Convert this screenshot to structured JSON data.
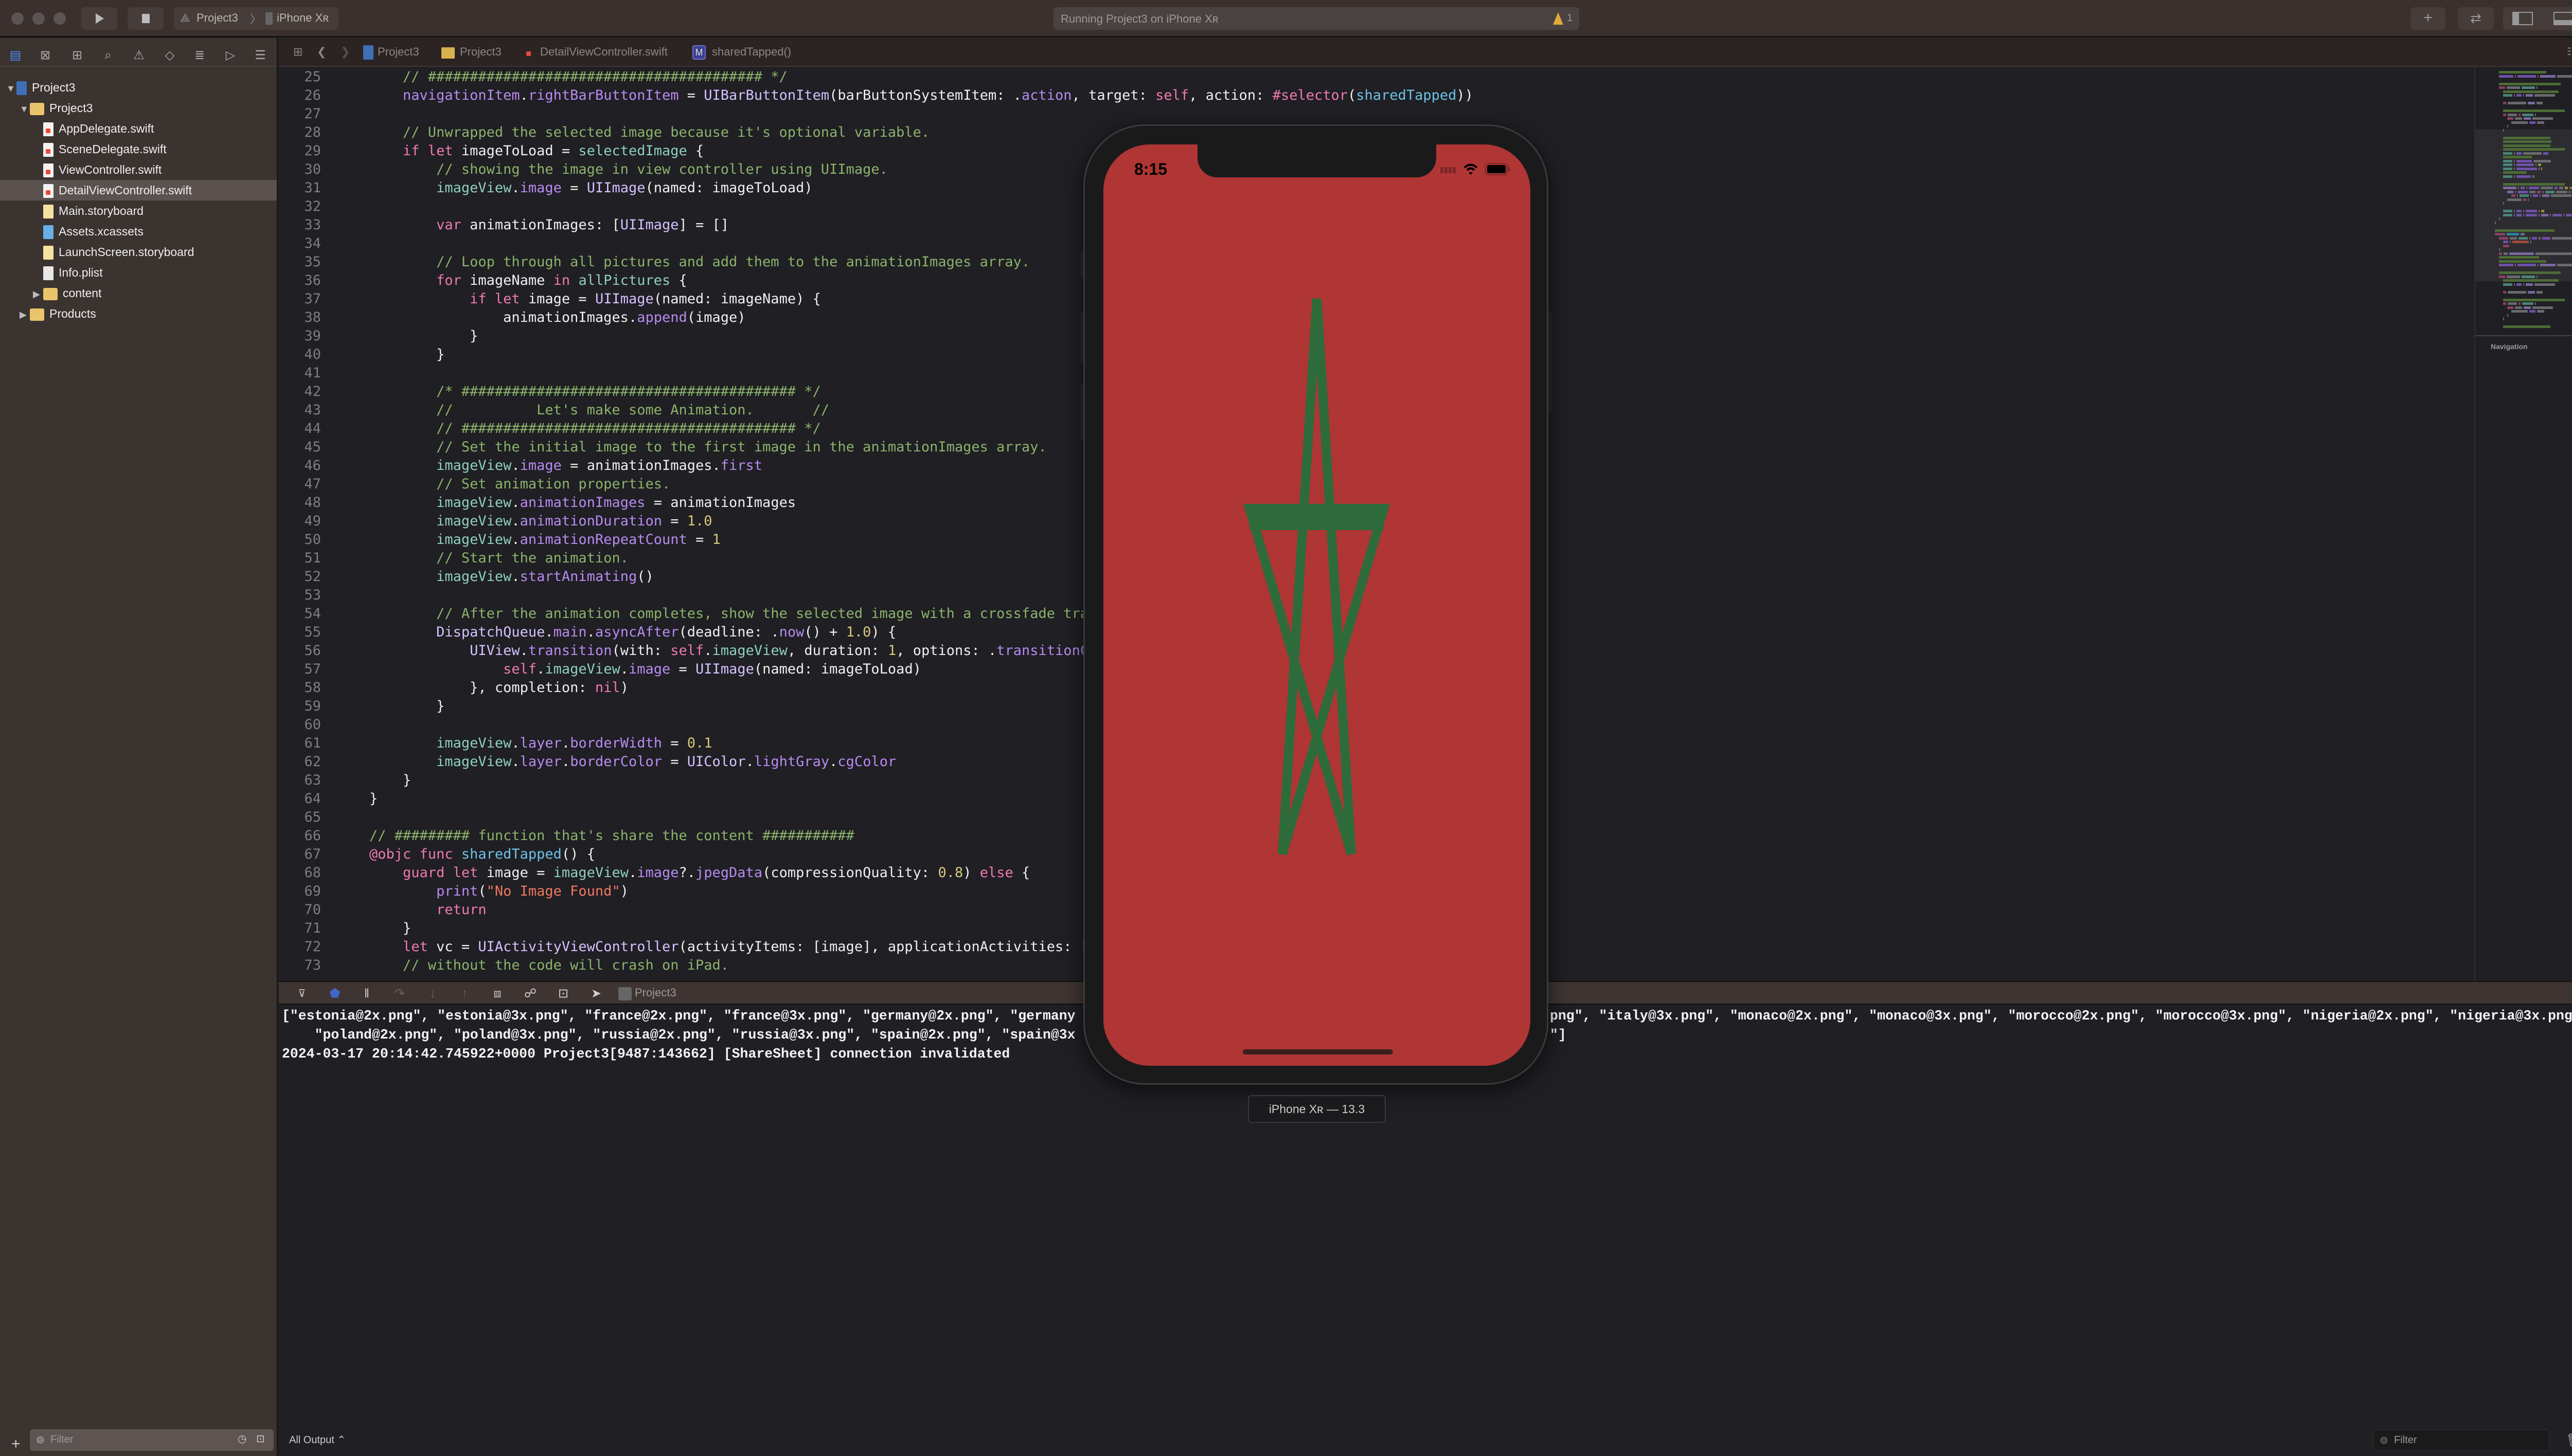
{
  "toolbar": {
    "scheme": "Project3",
    "device": "iPhone Xʀ",
    "activity": "Running Project3 on iPhone Xʀ",
    "warning_count": "1",
    "warning_color": "#e0a83a"
  },
  "navigator": {
    "items": [
      {
        "label": "Project3",
        "kind": "project"
      },
      {
        "label": "Project3",
        "kind": "folder"
      },
      {
        "label": "AppDelegate.swift",
        "kind": "swift"
      },
      {
        "label": "SceneDelegate.swift",
        "kind": "swift"
      },
      {
        "label": "ViewController.swift",
        "kind": "swift"
      },
      {
        "label": "DetailViewController.swift",
        "kind": "swift",
        "selected": true
      },
      {
        "label": "Main.storyboard",
        "kind": "storyboard"
      },
      {
        "label": "Assets.xcassets",
        "kind": "assets"
      },
      {
        "label": "LaunchScreen.storyboard",
        "kind": "storyboard"
      },
      {
        "label": "Info.plist",
        "kind": "plist"
      },
      {
        "label": "content",
        "kind": "folder"
      },
      {
        "label": "Products",
        "kind": "folder"
      }
    ],
    "filter_placeholder": "Filter"
  },
  "jumpbar": {
    "crumbs": [
      "Project3",
      "Project3",
      "DetailViewController.swift",
      "sharedTapped()"
    ],
    "method_badge": "M"
  },
  "editor": {
    "lines": [
      {
        "n": "25",
        "tokens": [
          {
            "t": "c",
            "v": "        // ######################################## */"
          }
        ]
      },
      {
        "n": "26",
        "tokens": [
          {
            "t": "f",
            "v": "        navigationItem"
          },
          {
            "t": "p",
            "v": "."
          },
          {
            "t": "f",
            "v": "rightBarButtonItem"
          },
          {
            "t": "p",
            "v": " = "
          },
          {
            "t": "y",
            "v": "UIBarButtonItem"
          },
          {
            "t": "p",
            "v": "(barButtonSystemItem: ."
          },
          {
            "t": "f",
            "v": "action"
          },
          {
            "t": "p",
            "v": ", target: "
          },
          {
            "t": "k",
            "v": "self"
          },
          {
            "t": "p",
            "v": ", action: "
          },
          {
            "t": "k",
            "v": "#selector"
          },
          {
            "t": "p",
            "v": "("
          },
          {
            "t": "d",
            "v": "sharedTapped"
          },
          {
            "t": "p",
            "v": "))"
          }
        ]
      },
      {
        "n": "27",
        "tokens": []
      },
      {
        "n": "28",
        "tokens": [
          {
            "t": "c",
            "v": "        // Unwrapped the selected image because it's optional variable."
          }
        ]
      },
      {
        "n": "29",
        "tokens": [
          {
            "t": "k",
            "v": "        if let"
          },
          {
            "t": "p",
            "v": " imageToLoad = "
          },
          {
            "t": "m",
            "v": "selectedImage"
          },
          {
            "t": "p",
            "v": " {"
          }
        ]
      },
      {
        "n": "30",
        "tokens": [
          {
            "t": "c",
            "v": "            // showing the image in view controller using UIImage."
          }
        ]
      },
      {
        "n": "31",
        "tokens": [
          {
            "t": "m",
            "v": "            imageView"
          },
          {
            "t": "p",
            "v": "."
          },
          {
            "t": "f",
            "v": "image"
          },
          {
            "t": "p",
            "v": " = "
          },
          {
            "t": "y",
            "v": "UIImage"
          },
          {
            "t": "p",
            "v": "(named: imageToLoad)"
          }
        ]
      },
      {
        "n": "32",
        "tokens": []
      },
      {
        "n": "33",
        "tokens": [
          {
            "t": "k",
            "v": "            var"
          },
          {
            "t": "p",
            "v": " animationImages: ["
          },
          {
            "t": "y",
            "v": "UIImage"
          },
          {
            "t": "p",
            "v": "] = []"
          }
        ]
      },
      {
        "n": "34",
        "tokens": []
      },
      {
        "n": "35",
        "tokens": [
          {
            "t": "c",
            "v": "            // Loop through all pictures and add them to the animationImages array."
          }
        ]
      },
      {
        "n": "36",
        "tokens": [
          {
            "t": "k",
            "v": "            for"
          },
          {
            "t": "p",
            "v": " imageName "
          },
          {
            "t": "k",
            "v": "in"
          },
          {
            "t": "p",
            "v": " "
          },
          {
            "t": "m",
            "v": "allPictures"
          },
          {
            "t": "p",
            "v": " {"
          }
        ]
      },
      {
        "n": "37",
        "tokens": [
          {
            "t": "k",
            "v": "                if let"
          },
          {
            "t": "p",
            "v": " image = "
          },
          {
            "t": "y",
            "v": "UIImage"
          },
          {
            "t": "p",
            "v": "(named: imageName) {"
          }
        ]
      },
      {
        "n": "38",
        "tokens": [
          {
            "t": "p",
            "v": "                    animationImages."
          },
          {
            "t": "f",
            "v": "append"
          },
          {
            "t": "p",
            "v": "(image)"
          }
        ]
      },
      {
        "n": "39",
        "tokens": [
          {
            "t": "p",
            "v": "                }"
          }
        ]
      },
      {
        "n": "40",
        "tokens": [
          {
            "t": "p",
            "v": "            }"
          }
        ]
      },
      {
        "n": "41",
        "tokens": []
      },
      {
        "n": "42",
        "tokens": [
          {
            "t": "c",
            "v": "            /* ######################################## */"
          }
        ]
      },
      {
        "n": "43",
        "tokens": [
          {
            "t": "c",
            "v": "            //          Let's make some Animation.       //"
          }
        ]
      },
      {
        "n": "44",
        "tokens": [
          {
            "t": "c",
            "v": "            // ######################################## */"
          }
        ]
      },
      {
        "n": "45",
        "tokens": [
          {
            "t": "c",
            "v": "            // Set the initial image to the first image in the animationImages array."
          }
        ]
      },
      {
        "n": "46",
        "tokens": [
          {
            "t": "m",
            "v": "            imageView"
          },
          {
            "t": "p",
            "v": "."
          },
          {
            "t": "f",
            "v": "image"
          },
          {
            "t": "p",
            "v": " = animationImages."
          },
          {
            "t": "f",
            "v": "first"
          }
        ]
      },
      {
        "n": "47",
        "tokens": [
          {
            "t": "c",
            "v": "            // Set animation properties."
          }
        ]
      },
      {
        "n": "48",
        "tokens": [
          {
            "t": "m",
            "v": "            imageView"
          },
          {
            "t": "p",
            "v": "."
          },
          {
            "t": "f",
            "v": "animationImages"
          },
          {
            "t": "p",
            "v": " = animationImages"
          }
        ]
      },
      {
        "n": "49",
        "tokens": [
          {
            "t": "m",
            "v": "            imageView"
          },
          {
            "t": "p",
            "v": "."
          },
          {
            "t": "f",
            "v": "animationDuration"
          },
          {
            "t": "p",
            "v": " = "
          },
          {
            "t": "n",
            "v": "1.0"
          }
        ]
      },
      {
        "n": "50",
        "tokens": [
          {
            "t": "m",
            "v": "            imageView"
          },
          {
            "t": "p",
            "v": "."
          },
          {
            "t": "f",
            "v": "animationRepeatCount"
          },
          {
            "t": "p",
            "v": " = "
          },
          {
            "t": "n",
            "v": "1"
          }
        ]
      },
      {
        "n": "51",
        "tokens": [
          {
            "t": "c",
            "v": "            // Start the animation."
          }
        ]
      },
      {
        "n": "52",
        "tokens": [
          {
            "t": "m",
            "v": "            imageView"
          },
          {
            "t": "p",
            "v": "."
          },
          {
            "t": "f",
            "v": "startAnimating"
          },
          {
            "t": "p",
            "v": "()"
          }
        ]
      },
      {
        "n": "53",
        "tokens": []
      },
      {
        "n": "54",
        "tokens": [
          {
            "t": "c",
            "v": "            // After the animation completes, show the selected image with a crossfade tran"
          }
        ]
      },
      {
        "n": "55",
        "tokens": [
          {
            "t": "y",
            "v": "            DispatchQueue"
          },
          {
            "t": "p",
            "v": "."
          },
          {
            "t": "f",
            "v": "main"
          },
          {
            "t": "p",
            "v": "."
          },
          {
            "t": "f",
            "v": "asyncAfter"
          },
          {
            "t": "p",
            "v": "(deadline: ."
          },
          {
            "t": "f",
            "v": "now"
          },
          {
            "t": "p",
            "v": "() + "
          },
          {
            "t": "n",
            "v": "1.0"
          },
          {
            "t": "p",
            "v": ") {"
          }
        ]
      },
      {
        "n": "56",
        "tokens": [
          {
            "t": "y",
            "v": "                UIView"
          },
          {
            "t": "p",
            "v": "."
          },
          {
            "t": "f",
            "v": "transition"
          },
          {
            "t": "p",
            "v": "(with: "
          },
          {
            "t": "k",
            "v": "self"
          },
          {
            "t": "p",
            "v": "."
          },
          {
            "t": "m",
            "v": "imageView"
          },
          {
            "t": "p",
            "v": ", duration: "
          },
          {
            "t": "n",
            "v": "1"
          },
          {
            "t": "p",
            "v": ", options: ."
          },
          {
            "t": "f",
            "v": "transitionCr"
          }
        ]
      },
      {
        "n": "57",
        "tokens": [
          {
            "t": "k",
            "v": "                    self"
          },
          {
            "t": "p",
            "v": "."
          },
          {
            "t": "m",
            "v": "imageView"
          },
          {
            "t": "p",
            "v": "."
          },
          {
            "t": "f",
            "v": "image"
          },
          {
            "t": "p",
            "v": " = "
          },
          {
            "t": "y",
            "v": "UIImage"
          },
          {
            "t": "p",
            "v": "(named: imageToLoad)"
          }
        ]
      },
      {
        "n": "58",
        "tokens": [
          {
            "t": "p",
            "v": "                }, completion: "
          },
          {
            "t": "k",
            "v": "nil"
          },
          {
            "t": "p",
            "v": ")"
          }
        ]
      },
      {
        "n": "59",
        "tokens": [
          {
            "t": "p",
            "v": "            }"
          }
        ]
      },
      {
        "n": "60",
        "tokens": []
      },
      {
        "n": "61",
        "tokens": [
          {
            "t": "m",
            "v": "            imageView"
          },
          {
            "t": "p",
            "v": "."
          },
          {
            "t": "f",
            "v": "layer"
          },
          {
            "t": "p",
            "v": "."
          },
          {
            "t": "f",
            "v": "borderWidth"
          },
          {
            "t": "p",
            "v": " = "
          },
          {
            "t": "n",
            "v": "0.1"
          }
        ]
      },
      {
        "n": "62",
        "tokens": [
          {
            "t": "m",
            "v": "            imageView"
          },
          {
            "t": "p",
            "v": "."
          },
          {
            "t": "f",
            "v": "layer"
          },
          {
            "t": "p",
            "v": "."
          },
          {
            "t": "f",
            "v": "borderColor"
          },
          {
            "t": "p",
            "v": " = "
          },
          {
            "t": "y",
            "v": "UIColor"
          },
          {
            "t": "p",
            "v": "."
          },
          {
            "t": "f",
            "v": "lightGray"
          },
          {
            "t": "p",
            "v": "."
          },
          {
            "t": "f",
            "v": "cgColor"
          }
        ]
      },
      {
        "n": "63",
        "tokens": [
          {
            "t": "p",
            "v": "        }"
          }
        ]
      },
      {
        "n": "64",
        "tokens": [
          {
            "t": "p",
            "v": "    }"
          }
        ]
      },
      {
        "n": "65",
        "tokens": []
      },
      {
        "n": "66",
        "tokens": [
          {
            "t": "c",
            "v": "    // ######### function that's share the content ###########"
          }
        ]
      },
      {
        "n": "67",
        "tokens": [
          {
            "t": "k",
            "v": "    @objc func"
          },
          {
            "t": "p",
            "v": " "
          },
          {
            "t": "d",
            "v": "sharedTapped"
          },
          {
            "t": "p",
            "v": "() {"
          }
        ]
      },
      {
        "n": "68",
        "tokens": [
          {
            "t": "k",
            "v": "        guard let"
          },
          {
            "t": "p",
            "v": " image = "
          },
          {
            "t": "m",
            "v": "imageView"
          },
          {
            "t": "p",
            "v": "."
          },
          {
            "t": "f",
            "v": "image"
          },
          {
            "t": "p",
            "v": "?."
          },
          {
            "t": "f",
            "v": "jpegData"
          },
          {
            "t": "p",
            "v": "(compressionQuality: "
          },
          {
            "t": "n",
            "v": "0.8"
          },
          {
            "t": "p",
            "v": ") "
          },
          {
            "t": "k",
            "v": "else"
          },
          {
            "t": "p",
            "v": " {"
          }
        ]
      },
      {
        "n": "69",
        "tokens": [
          {
            "t": "f",
            "v": "            print"
          },
          {
            "t": "p",
            "v": "("
          },
          {
            "t": "s",
            "v": "\"No Image Found\""
          },
          {
            "t": "p",
            "v": ")"
          }
        ]
      },
      {
        "n": "70",
        "tokens": [
          {
            "t": "k",
            "v": "            return"
          }
        ]
      },
      {
        "n": "71",
        "tokens": [
          {
            "t": "p",
            "v": "        }"
          }
        ]
      },
      {
        "n": "72",
        "tokens": [
          {
            "t": "k",
            "v": "        let"
          },
          {
            "t": "p",
            "v": " vc = "
          },
          {
            "t": "y",
            "v": "UIActivityViewController"
          },
          {
            "t": "p",
            "v": "(activityItems: [image], applicationActivities: []"
          }
        ]
      },
      {
        "n": "73",
        "tokens": [
          {
            "t": "c",
            "v": "        // without the code will crash on iPad."
          }
        ]
      }
    ],
    "minimap_heading": "Navigation"
  },
  "debugbar": {
    "process": "Project3"
  },
  "console": {
    "line1_left": "[\"estonia@2x.png\", \"estonia@3x.png\", \"france@2x.png\", \"france@3x.png\", \"germany@2x.png\", \"germany",
    "line1_right": "png\", \"italy@3x.png\", \"monaco@2x.png\", \"monaco@3x.png\", \"morocco@2x.png\", \"morocco@3x.png\", \"nigeria@2x.png\", \"nigeria@3x.png\",",
    "line2_left": "    \"poland@2x.png\", \"poland@3x.png\", \"russia@2x.png\", \"russia@3x.png\", \"spain@2x.png\", \"spain@3x",
    "line2_right": "\"]",
    "line3": "2024-03-17 20:14:42.745922+0000 Project3[9487:143662] [ShareSheet] connection invalidated",
    "output_selector": "All Output ⌃",
    "filter_placeholder": "Filter"
  },
  "simulator": {
    "time": "8:15",
    "device_label": "iPhone Xʀ — 13.3",
    "flag_red": "#b03535",
    "flag_green": "#2d6b3a"
  }
}
